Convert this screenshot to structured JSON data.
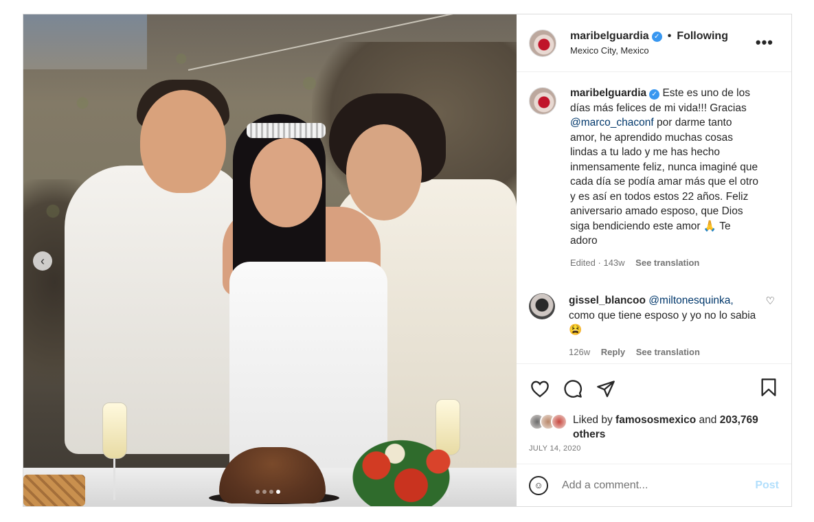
{
  "header": {
    "username": "maribelguardia",
    "separator": "•",
    "follow_status": "Following",
    "location": "Mexico City, Mexico",
    "more_label": "•••"
  },
  "caption": {
    "username": "maribelguardia",
    "text_1": "Este es uno de los días más felices de mi vida!!! Gracias",
    "mention": "@marco_chaconf",
    "text_2": "por darme tanto amor, he aprendido muchas cosas lindas a tu lado y me has hecho inmensamente feliz, nunca imaginé que cada día se podía amar más que el otro y es así en todos estos 22 años. Feliz aniversario amado esposo, que Dios siga bendiciendo este amor 🙏 Te adoro",
    "edited": "Edited",
    "dot": "·",
    "age": "143w",
    "see_translation": "See translation"
  },
  "comment": {
    "username": "gissel_blancoo",
    "mention": "@miltonesquinka,",
    "text": "como que tiene esposo y yo no lo sabia 😫",
    "age": "126w",
    "reply": "Reply",
    "see_translation": "See translation"
  },
  "likes": {
    "prefix": "Liked by",
    "user": "famososmexico",
    "and": "and",
    "count": "203,769",
    "suffix": "others"
  },
  "date": "JULY 14, 2020",
  "add_comment": {
    "placeholder": "Add a comment...",
    "post_label": "Post"
  },
  "carousel": {
    "slide_count": 4,
    "active_index": 3
  },
  "icons": {
    "verified": "verified-badge-icon",
    "like": "heart-icon",
    "comment": "comment-icon",
    "share": "share-icon",
    "save": "bookmark-icon",
    "emoji": "emoji-icon",
    "prev": "chevron-left-icon"
  },
  "colors": {
    "verified": "#3897f0",
    "link": "#00376b",
    "post_disabled": "#b2dffc",
    "muted": "#737373"
  }
}
